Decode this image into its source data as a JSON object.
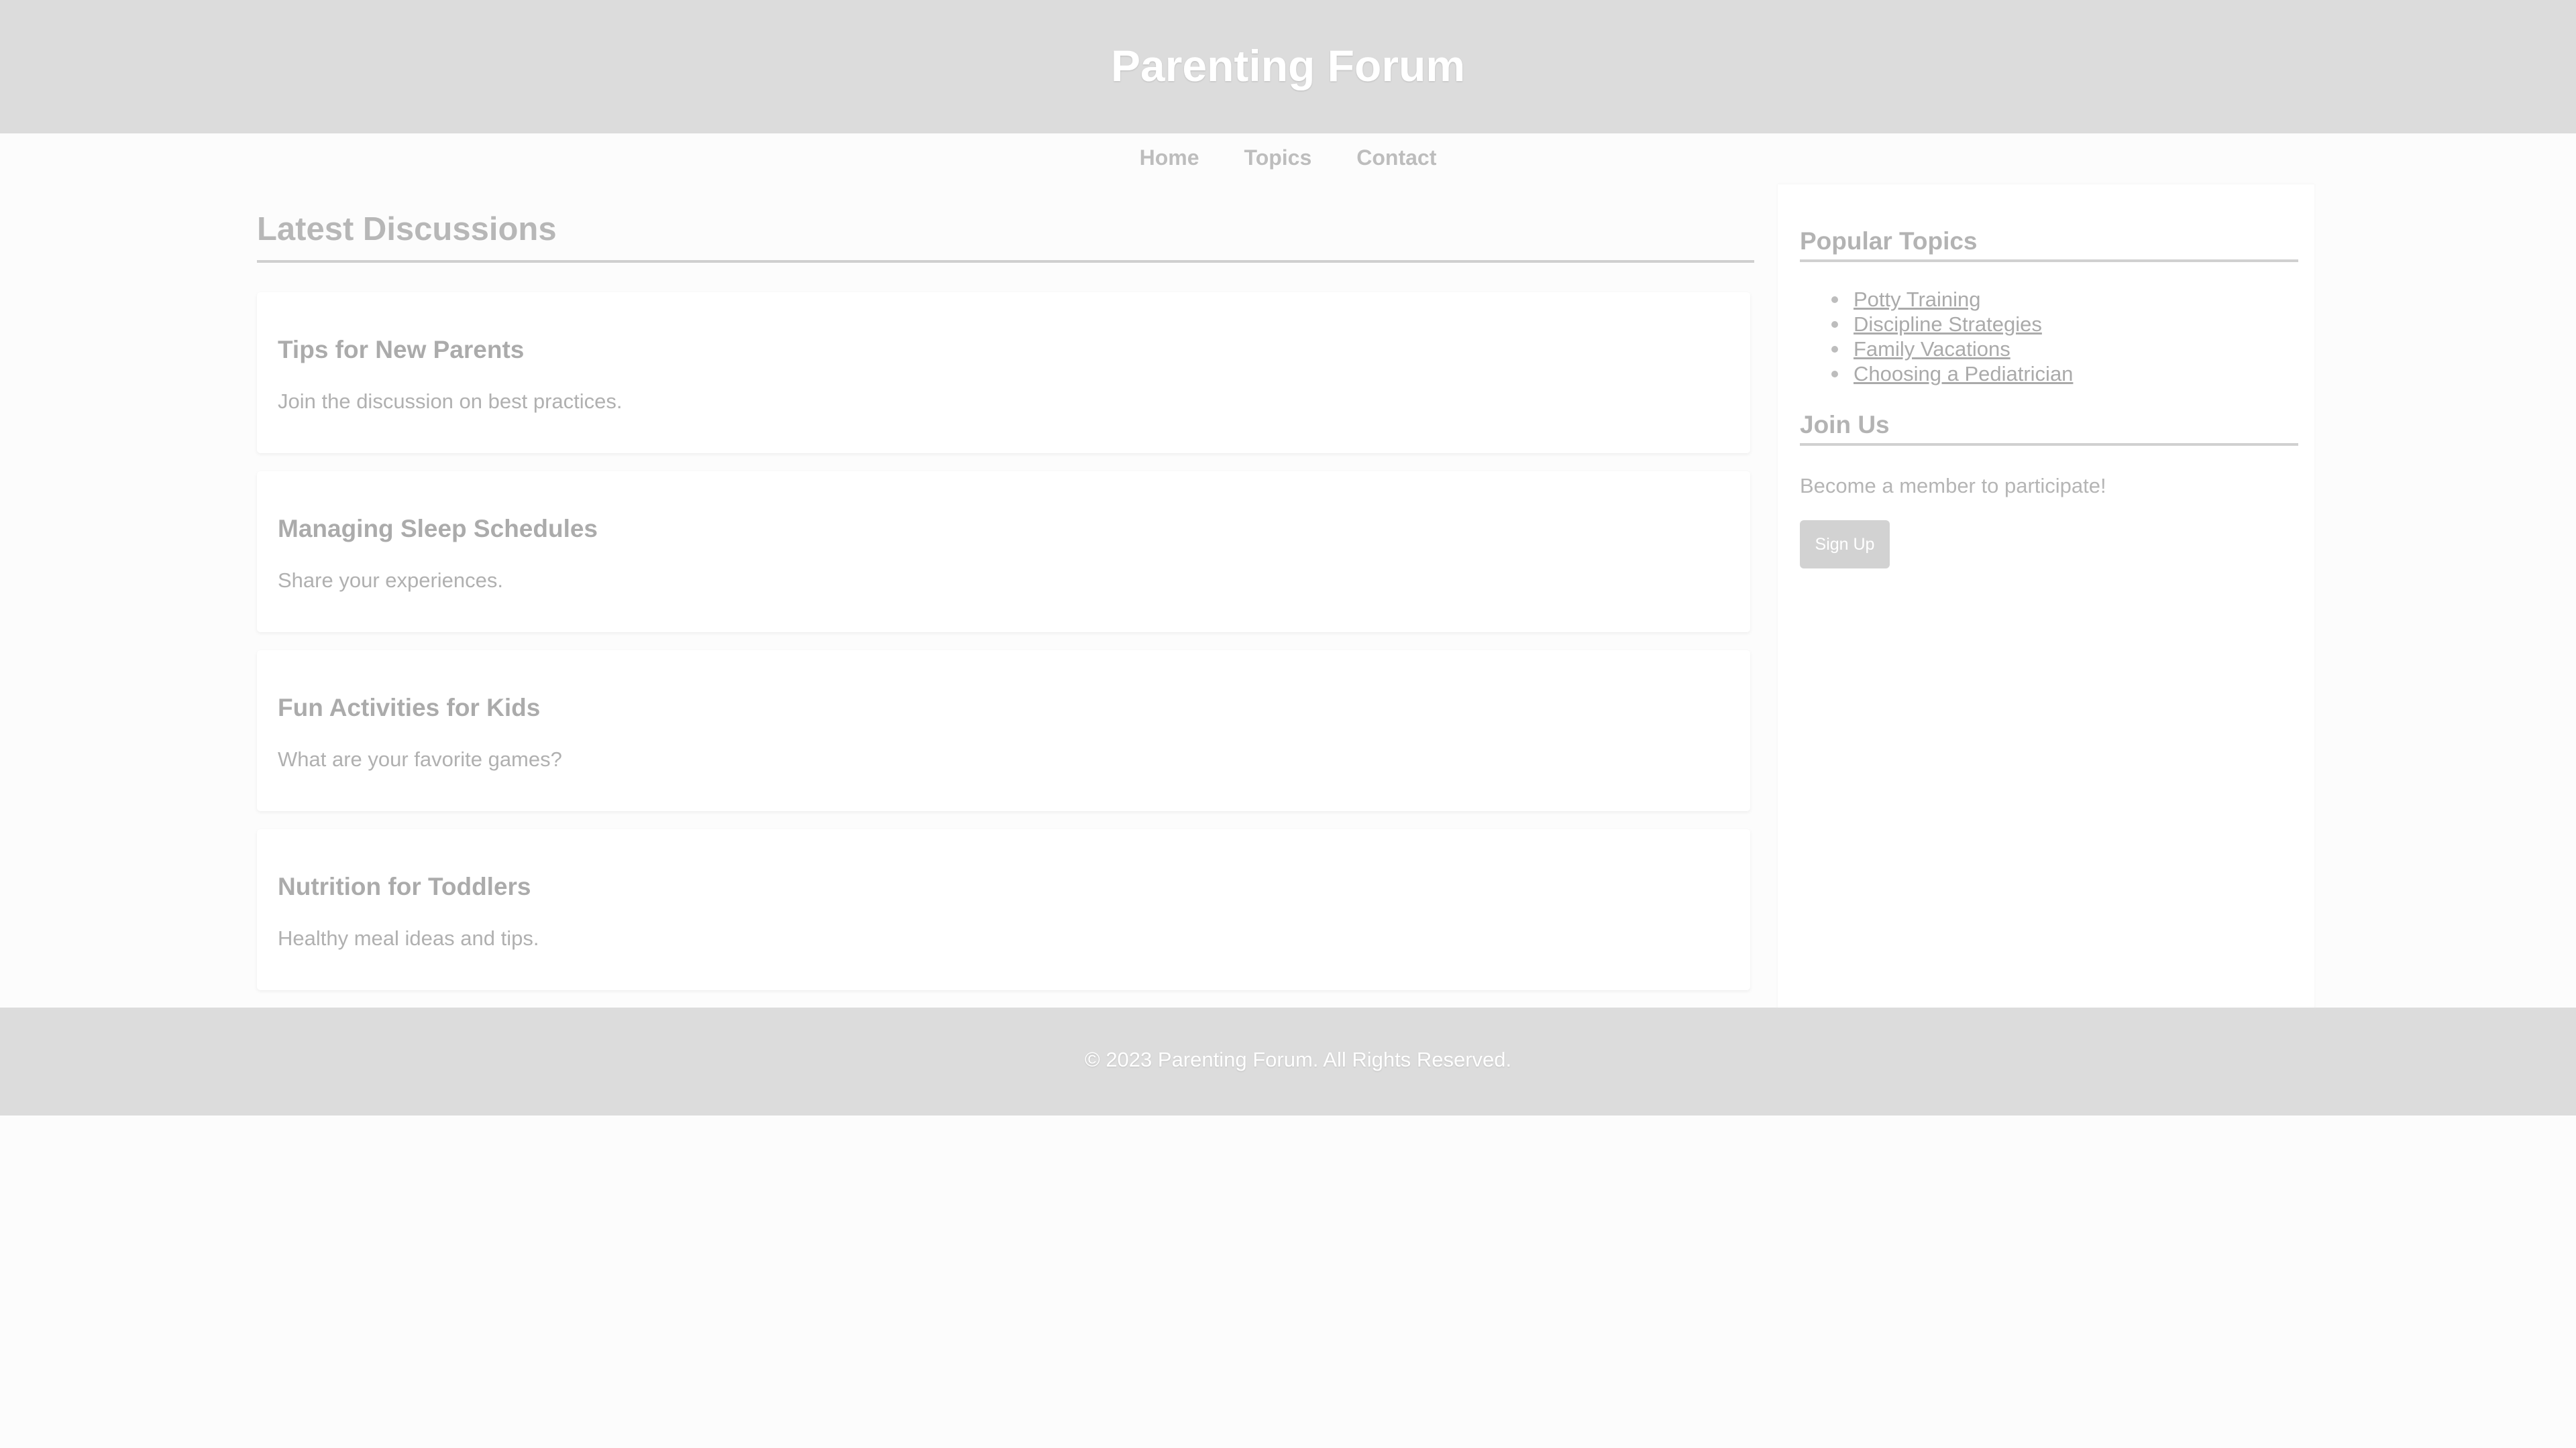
{
  "header": {
    "title": "Parenting Forum"
  },
  "nav": {
    "items": [
      {
        "label": "Home"
      },
      {
        "label": "Topics"
      },
      {
        "label": "Contact"
      }
    ]
  },
  "main": {
    "heading": "Latest Discussions",
    "discussions": [
      {
        "title": "Tips for New Parents",
        "description": "Join the discussion on best practices."
      },
      {
        "title": "Managing Sleep Schedules",
        "description": "Share your experiences."
      },
      {
        "title": "Fun Activities for Kids",
        "description": "What are your favorite games?"
      },
      {
        "title": "Nutrition for Toddlers",
        "description": "Healthy meal ideas and tips."
      }
    ]
  },
  "sidebar": {
    "popular_heading": "Popular Topics",
    "topics": [
      {
        "label": "Potty Training"
      },
      {
        "label": "Discipline Strategies"
      },
      {
        "label": "Family Vacations"
      },
      {
        "label": "Choosing a Pediatrician"
      }
    ],
    "join_heading": "Join Us",
    "join_text": "Become a member to participate!",
    "signup_label": "Sign Up"
  },
  "footer": {
    "text": "© 2023 Parenting Forum. All Rights Reserved."
  },
  "colors": {
    "header_bg": "#dcdcdc",
    "footer_bg": "#dcdcdc",
    "page_bg": "#fcfcfc",
    "button_bg": "#d2d2d2"
  }
}
